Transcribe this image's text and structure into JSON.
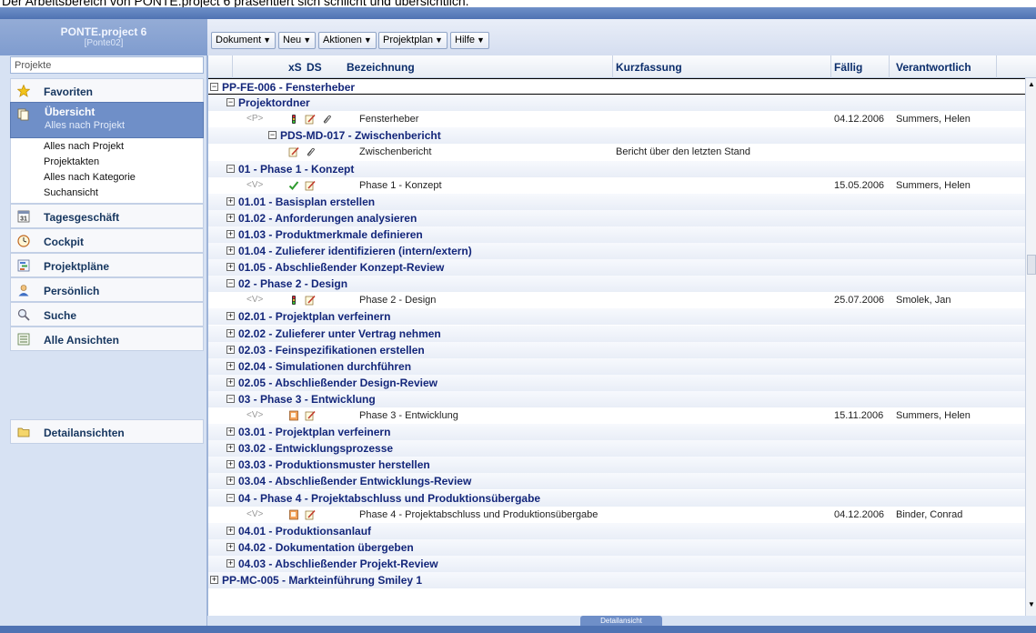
{
  "caption": "Der Arbeitsbereich von PONTE.project 6 präsentiert sich schlicht und übersichtlich.",
  "sidebar": {
    "app_title": "PONTE.project 6",
    "app_subtitle": "[Ponte02]",
    "projects_label": "Projekte",
    "favoriten": "Favoriten",
    "uebersicht": "Übersicht",
    "uebersicht_sub": "Alles nach Projekt",
    "sublinks": [
      "Alles nach Projekt",
      "Projektakten",
      "Alles nach Kategorie",
      "Suchansicht"
    ],
    "tagesgeschaeft": "Tagesgeschäft",
    "cockpit": "Cockpit",
    "projektplaene": "Projektpläne",
    "persoenlich": "Persönlich",
    "suche": "Suche",
    "alle_ansichten": "Alle Ansichten",
    "detailansichten": "Detailansichten"
  },
  "toolbar": {
    "dokument": "Dokument",
    "neu": "Neu",
    "aktionen": "Aktionen",
    "projektplan": "Projektplan",
    "hilfe": "Hilfe"
  },
  "columns": {
    "xs": "xS",
    "ds": "DS",
    "bezeichnung": "Bezeichnung",
    "kurzfassung": "Kurzfassung",
    "faellig": "Fällig",
    "verantwortlich": "Verantwortlich"
  },
  "rows": [
    {
      "kind": "top",
      "expander": "⊟",
      "text": "PP-FE-006  -  Fensterheber"
    },
    {
      "kind": "group",
      "level": 1,
      "expander": "⊟",
      "text": "Projektordner"
    },
    {
      "kind": "item",
      "tag": "<P>",
      "status": [
        "ampel",
        "pencil",
        "clip"
      ],
      "name": "Fensterheber",
      "kurz": "",
      "faellig": "04.12.2006",
      "verantw": "Summers, Helen"
    },
    {
      "kind": "group",
      "level": 2,
      "expander": "⊟",
      "text": "PDS-MD-017  -  Zwischenbericht"
    },
    {
      "kind": "item",
      "tag": "",
      "status": [
        "pencil",
        "clip"
      ],
      "name": "Zwischenbericht",
      "kurz": "Bericht über den letzten Stand",
      "faellig": "",
      "verantw": ""
    },
    {
      "kind": "group",
      "level": 1,
      "expander": "⊟",
      "text": "01  -  Phase 1 - Konzept"
    },
    {
      "kind": "item",
      "tag": "<V>",
      "status": [
        "check",
        "pencil"
      ],
      "name": "Phase 1 - Konzept",
      "kurz": "",
      "faellig": "15.05.2006",
      "verantw": "Summers, Helen"
    },
    {
      "kind": "group",
      "level": 1,
      "expander": "⊞",
      "text": "01.01  -  Basisplan erstellen"
    },
    {
      "kind": "group",
      "level": 1,
      "expander": "⊞",
      "text": "01.02  -  Anforderungen analysieren"
    },
    {
      "kind": "group",
      "level": 1,
      "expander": "⊞",
      "text": "01.03  -  Produktmerkmale definieren"
    },
    {
      "kind": "group",
      "level": 1,
      "expander": "⊞",
      "text": "01.04  -  Zulieferer identifizieren (intern/extern)"
    },
    {
      "kind": "group",
      "level": 1,
      "expander": "⊞",
      "text": "01.05  -  Abschließender Konzept-Review"
    },
    {
      "kind": "group",
      "level": 1,
      "expander": "⊟",
      "text": "02  -  Phase 2 - Design"
    },
    {
      "kind": "item",
      "tag": "<V>",
      "status": [
        "ampel",
        "pencil"
      ],
      "name": "Phase 2 - Design",
      "kurz": "",
      "faellig": "25.07.2006",
      "verantw": "Smolek, Jan"
    },
    {
      "kind": "group",
      "level": 1,
      "expander": "⊞",
      "text": "02.01  -  Projektplan verfeinern"
    },
    {
      "kind": "group",
      "level": 1,
      "expander": "⊞",
      "text": "02.02  -  Zulieferer unter Vertrag nehmen"
    },
    {
      "kind": "group",
      "level": 1,
      "expander": "⊞",
      "text": "02.03  -  Feinspezifikationen erstellen"
    },
    {
      "kind": "group",
      "level": 1,
      "expander": "⊞",
      "text": "02.04  -  Simulationen durchführen"
    },
    {
      "kind": "group",
      "level": 1,
      "expander": "⊞",
      "text": "02.05  -  Abschließender Design-Review"
    },
    {
      "kind": "group",
      "level": 1,
      "expander": "⊟",
      "text": "03  -  Phase 3 - Entwicklung"
    },
    {
      "kind": "item",
      "tag": "<V>",
      "status": [
        "doc",
        "pencil"
      ],
      "name": "Phase 3 - Entwicklung",
      "kurz": "",
      "faellig": "15.11.2006",
      "verantw": "Summers, Helen"
    },
    {
      "kind": "group",
      "level": 1,
      "expander": "⊞",
      "text": "03.01  -  Projektplan verfeinern"
    },
    {
      "kind": "group",
      "level": 1,
      "expander": "⊞",
      "text": "03.02  -  Entwicklungsprozesse"
    },
    {
      "kind": "group",
      "level": 1,
      "expander": "⊞",
      "text": "03.03  -  Produktionsmuster herstellen"
    },
    {
      "kind": "group",
      "level": 1,
      "expander": "⊞",
      "text": "03.04  -  Abschließender Entwicklungs-Review"
    },
    {
      "kind": "group",
      "level": 1,
      "expander": "⊟",
      "text": "04  -  Phase 4 - Projektabschluss und Produktionsübergabe"
    },
    {
      "kind": "item",
      "tag": "<V>",
      "status": [
        "doc",
        "pencil"
      ],
      "name": "Phase 4 - Projektabschluss und Produktionsübergabe",
      "kurz": "",
      "faellig": "04.12.2006",
      "verantw": "Binder, Conrad"
    },
    {
      "kind": "group",
      "level": 1,
      "expander": "⊞",
      "text": "04.01  -  Produktionsanlauf"
    },
    {
      "kind": "group",
      "level": 1,
      "expander": "⊞",
      "text": "04.02  -  Dokumentation übergeben"
    },
    {
      "kind": "group",
      "level": 1,
      "expander": "⊞",
      "text": "04.03  -  Abschließender Projekt-Review"
    },
    {
      "kind": "group",
      "level": 0,
      "expander": "⊞",
      "text": "PP-MC-005  -  Markteinführung Smiley 1"
    }
  ],
  "status_tab": "Detailansicht",
  "colors": {
    "accent": "#6f8fc8",
    "group_text": "#13267a",
    "header_text": "#0b2d6b",
    "check": "#2f9b2f"
  },
  "icons": {
    "favoriten": "star-icon",
    "uebersicht": "document-stack-icon",
    "tagesgeschaeft": "calendar-icon",
    "cockpit": "clock-icon",
    "projektplaene": "plan-grid-icon",
    "persoenlich": "person-icon",
    "suche": "magnifier-icon",
    "alle_ansichten": "list-view-icon",
    "detailansichten": "folder-icon"
  }
}
